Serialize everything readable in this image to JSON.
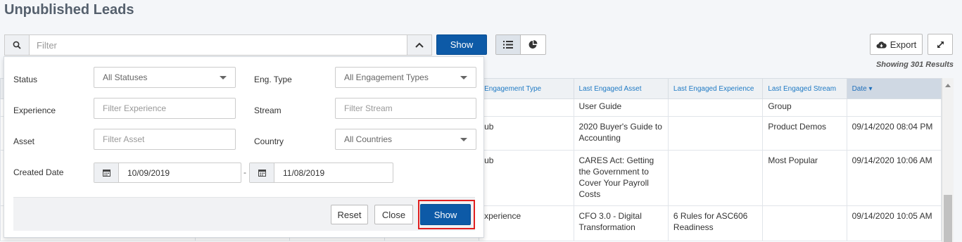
{
  "page": {
    "title": "Unpublished Leads"
  },
  "toolbar": {
    "filter_placeholder": "Filter",
    "show_label": "Show",
    "export_label": "Export",
    "results_count": "Showing 301 Results"
  },
  "icons": {
    "search": "search-icon",
    "collapse": "chevron-up-icon",
    "list_view": "list-icon",
    "chart_view": "pie-chart-icon",
    "export": "cloud-download-icon",
    "expand": "expand-icon",
    "calendar": "calendar-icon"
  },
  "colors": {
    "primary": "#0d5aa7",
    "highlight": "#e02020",
    "link": "#1f7ac4"
  },
  "filter_panel": {
    "status": {
      "label": "Status",
      "value": "All Statuses"
    },
    "eng_type": {
      "label": "Eng. Type",
      "value": "All Engagement Types"
    },
    "experience": {
      "label": "Experience",
      "placeholder": "Filter Experience"
    },
    "stream": {
      "label": "Stream",
      "placeholder": "Filter Stream"
    },
    "asset": {
      "label": "Asset",
      "placeholder": "Filter Asset"
    },
    "country": {
      "label": "Country",
      "value": "All Countries"
    },
    "created_date": {
      "label": "Created Date",
      "from": "10/09/2019",
      "separator": "-",
      "to": "11/08/2019"
    },
    "reset_label": "Reset",
    "close_label": "Close",
    "show_label": "Show"
  },
  "table": {
    "headers": [
      "Engagement Type",
      "Last Engaged Asset",
      "Last Engaged Experience",
      "Last Engaged Stream",
      "Date"
    ],
    "sorted_column_label": "Date ▾",
    "rows": [
      [
        "",
        "User Guide",
        "",
        "Group",
        ""
      ],
      [
        "ub",
        "2020 Buyer's Guide to Accounting",
        "",
        "Product Demos",
        "09/14/2020 08:04 PM"
      ],
      [
        "ub",
        "CARES Act: Getting the Government to Cover Your Payroll Costs",
        "",
        "Most Popular",
        "09/14/2020 10:06 AM"
      ],
      [
        "xperience",
        "CFO 3.0 - Digital Transformation",
        "6 Rules for ASC606 Readiness",
        "",
        "09/14/2020 10:05 AM"
      ]
    ]
  }
}
